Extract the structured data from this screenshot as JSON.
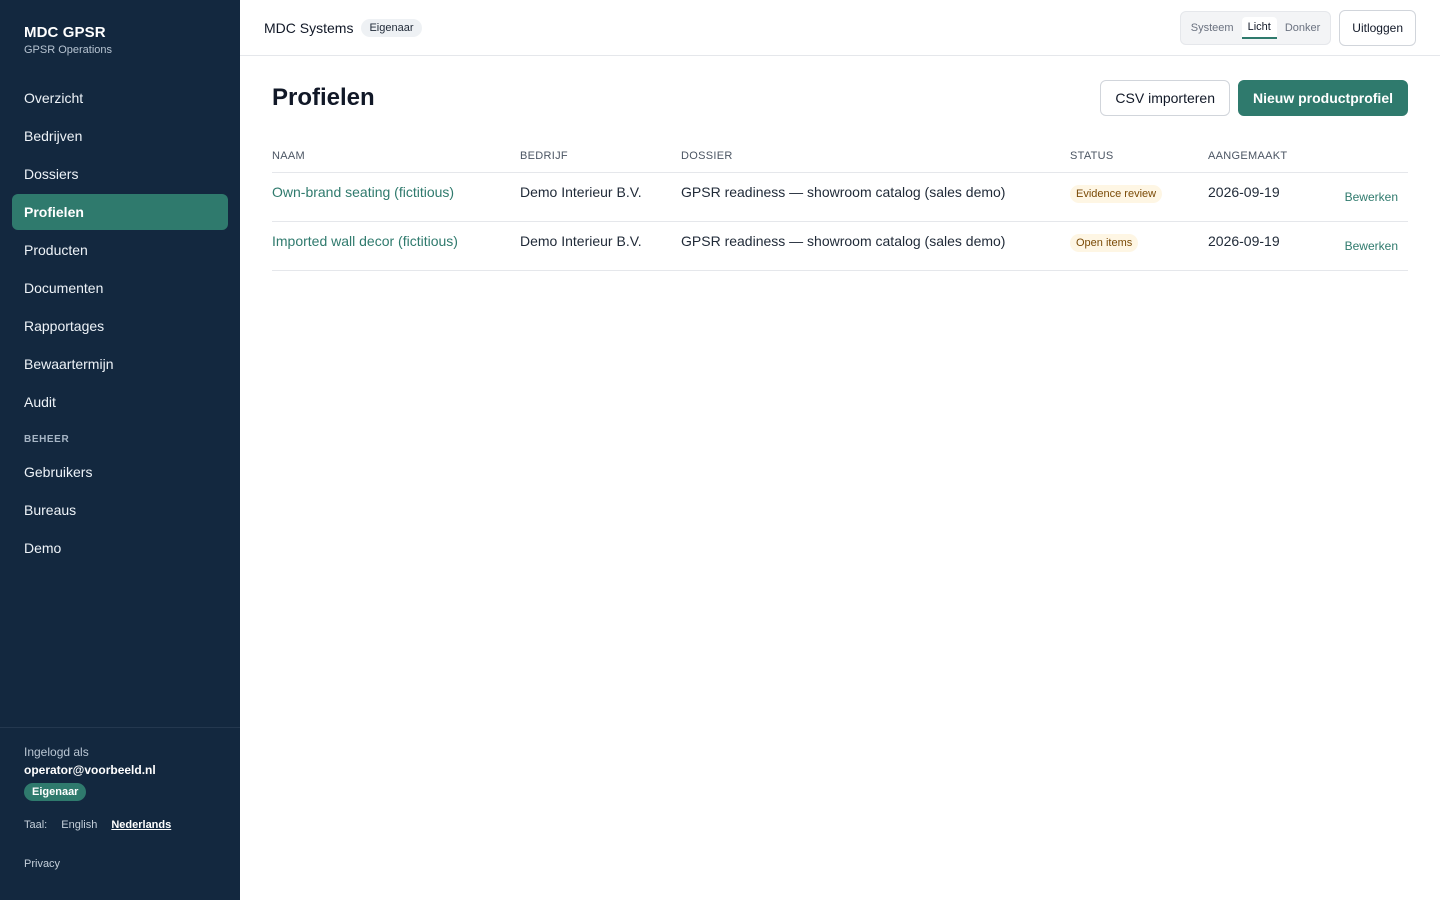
{
  "brand": {
    "title": "MDC GPSR",
    "subtitle": "GPSR Operations"
  },
  "nav": {
    "items": [
      {
        "label": "Overzicht"
      },
      {
        "label": "Bedrijven"
      },
      {
        "label": "Dossiers"
      },
      {
        "label": "Profielen",
        "active": true
      },
      {
        "label": "Producten"
      },
      {
        "label": "Documenten"
      },
      {
        "label": "Rapportages"
      },
      {
        "label": "Bewaartermijn"
      },
      {
        "label": "Audit"
      }
    ],
    "section_label": "BEHEER",
    "admin_items": [
      {
        "label": "Gebruikers"
      },
      {
        "label": "Bureaus"
      },
      {
        "label": "Demo"
      }
    ]
  },
  "footer": {
    "logged_in_label": "Ingelogd als",
    "email": "operator@voorbeeld.nl",
    "role": "Eigenaar",
    "language_label": "Taal:",
    "languages": [
      "English",
      "Nederlands"
    ],
    "active_language": "Nederlands",
    "privacy": "Privacy"
  },
  "topbar": {
    "org_name": "MDC Systems",
    "org_role": "Eigenaar",
    "theme_options": [
      "Systeem",
      "Licht",
      "Donker"
    ],
    "theme_active": "Licht",
    "logout_label": "Uitloggen"
  },
  "page": {
    "title": "Profielen",
    "import_button": "CSV importeren",
    "new_button": "Nieuw productprofiel"
  },
  "table": {
    "columns": [
      "NAAM",
      "BEDRIJF",
      "DOSSIER",
      "STATUS",
      "AANGEMAAKT"
    ],
    "rows": [
      {
        "name": "Own-brand seating (fictitious)",
        "company": "Demo Interieur B.V.",
        "dossier": "GPSR readiness — showroom catalog (sales demo)",
        "status": "Evidence review",
        "created": "2026-09-19",
        "action": "Bewerken"
      },
      {
        "name": "Imported wall decor (fictitious)",
        "company": "Demo Interieur B.V.",
        "dossier": "GPSR readiness — showroom catalog (sales demo)",
        "status": "Open items",
        "created": "2026-09-19",
        "action": "Bewerken"
      }
    ]
  },
  "colors": {
    "sidebar_bg": "#13283f",
    "accent": "#2f7a6d",
    "status_bg": "#fef6e4",
    "status_text": "#7a4a06"
  }
}
